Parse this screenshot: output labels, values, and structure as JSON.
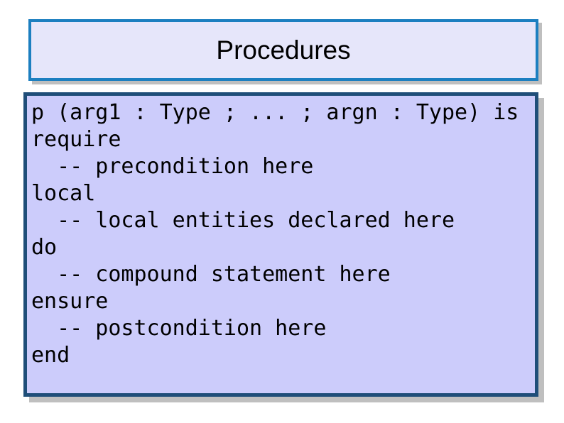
{
  "slide": {
    "background_color": "#ffffff",
    "title": {
      "text": "Procedures",
      "fill_color": "#e6e6fa",
      "border_color": "#1c7fc0",
      "shadow_color": "#bfbfbf"
    },
    "code_block": {
      "fill_color": "#ccccfb",
      "border_color": "#1f4e79",
      "shadow_color": "#bfbfbf",
      "language": "eiffel",
      "lines": [
        "p (arg1 : Type ; ... ; argn : Type) is",
        "require",
        "  -- precondition here",
        "local",
        "  -- local entities declared here",
        "do",
        "  -- compound statement here",
        "ensure",
        "  -- postcondition here",
        "end"
      ],
      "text": "p (arg1 : Type ; ... ; argn : Type) is\nrequire\n  -- precondition here\nlocal\n  -- local entities declared here\ndo\n  -- compound statement here\nensure\n  -- postcondition here\nend"
    }
  }
}
